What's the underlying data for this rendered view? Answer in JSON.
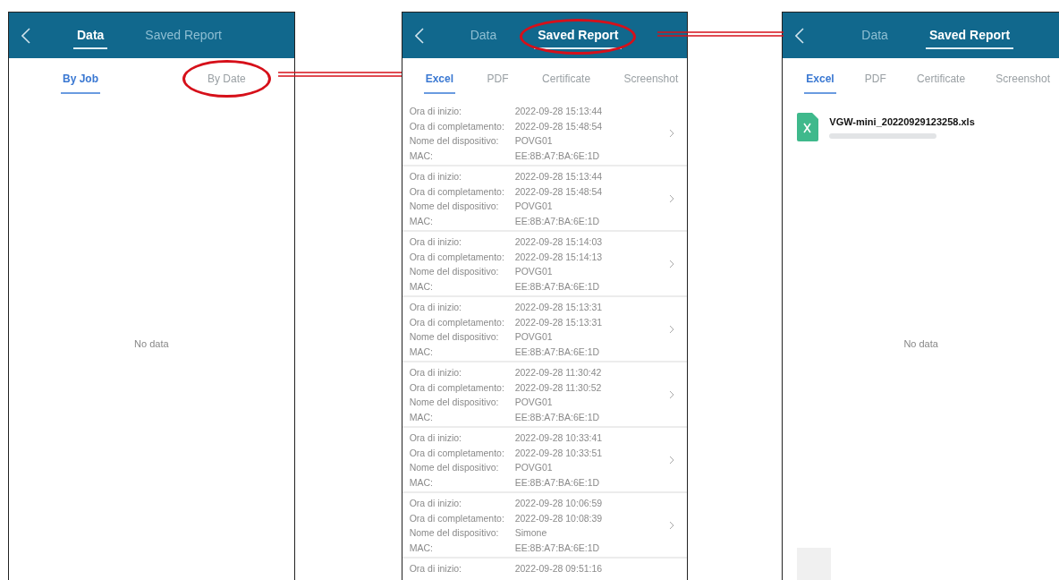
{
  "screens": [
    {
      "header": {
        "tabs": [
          {
            "label": "Data",
            "selected": true,
            "circled": false
          },
          {
            "label": "Saved Report",
            "selected": false,
            "circled": false
          }
        ]
      },
      "subtabs": [
        {
          "label": "By Job",
          "selected": true,
          "circled": false
        },
        {
          "label": "By Date",
          "selected": false,
          "circled": true
        }
      ],
      "content": {
        "kind": "empty",
        "message": "No data"
      }
    },
    {
      "header": {
        "tabs": [
          {
            "label": "Data",
            "selected": false,
            "circled": false
          },
          {
            "label": "Saved Report",
            "selected": true,
            "circled": true
          }
        ]
      },
      "subtabs": [
        {
          "label": "Excel",
          "selected": true,
          "circled": false
        },
        {
          "label": "PDF",
          "selected": false,
          "circled": false
        },
        {
          "label": "Certificate",
          "selected": false,
          "circled": false
        },
        {
          "label": "Screenshot",
          "selected": false,
          "circled": false
        }
      ],
      "content": {
        "kind": "list",
        "rows": [
          {
            "fields": [
              {
                "label": "Ora di inizio:",
                "value": "2022-09-28 15:13:44"
              },
              {
                "label": "Ora di completamento:",
                "value": "2022-09-28 15:48:54"
              },
              {
                "label": "Nome del dispositivo:",
                "value": "POVG01"
              },
              {
                "label": "MAC:",
                "value": "EE:8B:A7:BA:6E:1D"
              }
            ]
          },
          {
            "fields": [
              {
                "label": "Ora di inizio:",
                "value": "2022-09-28 15:13:44"
              },
              {
                "label": "Ora di completamento:",
                "value": "2022-09-28 15:48:54"
              },
              {
                "label": "Nome del dispositivo:",
                "value": "POVG01"
              },
              {
                "label": "MAC:",
                "value": "EE:8B:A7:BA:6E:1D"
              }
            ]
          },
          {
            "fields": [
              {
                "label": "Ora di inizio:",
                "value": "2022-09-28 15:14:03"
              },
              {
                "label": "Ora di completamento:",
                "value": "2022-09-28 15:14:13"
              },
              {
                "label": "Nome del dispositivo:",
                "value": "POVG01"
              },
              {
                "label": "MAC:",
                "value": "EE:8B:A7:BA:6E:1D"
              }
            ]
          },
          {
            "fields": [
              {
                "label": "Ora di inizio:",
                "value": "2022-09-28 15:13:31"
              },
              {
                "label": "Ora di completamento:",
                "value": "2022-09-28 15:13:31"
              },
              {
                "label": "Nome del dispositivo:",
                "value": "POVG01"
              },
              {
                "label": "MAC:",
                "value": "EE:8B:A7:BA:6E:1D"
              }
            ]
          },
          {
            "fields": [
              {
                "label": "Ora di inizio:",
                "value": "2022-09-28 11:30:42"
              },
              {
                "label": "Ora di completamento:",
                "value": "2022-09-28 11:30:52"
              },
              {
                "label": "Nome del dispositivo:",
                "value": "POVG01"
              },
              {
                "label": "MAC:",
                "value": "EE:8B:A7:BA:6E:1D"
              }
            ]
          },
          {
            "fields": [
              {
                "label": "Ora di inizio:",
                "value": "2022-09-28 10:33:41"
              },
              {
                "label": "Ora di completamento:",
                "value": "2022-09-28 10:33:51"
              },
              {
                "label": "Nome del dispositivo:",
                "value": "POVG01"
              },
              {
                "label": "MAC:",
                "value": "EE:8B:A7:BA:6E:1D"
              }
            ]
          },
          {
            "fields": [
              {
                "label": "Ora di inizio:",
                "value": "2022-09-28 10:06:59"
              },
              {
                "label": "Ora di completamento:",
                "value": "2022-09-28 10:08:39"
              },
              {
                "label": "Nome del dispositivo:",
                "value": "Simone"
              },
              {
                "label": "MAC:",
                "value": "EE:8B:A7:BA:6E:1D"
              }
            ]
          },
          {
            "fields": [
              {
                "label": "Ora di inizio:",
                "value": "2022-09-28 09:51:16"
              }
            ]
          }
        ]
      }
    },
    {
      "header": {
        "tabs": [
          {
            "label": "Data",
            "selected": false,
            "circled": false
          },
          {
            "label": "Saved Report",
            "selected": true,
            "circled": false
          }
        ]
      },
      "subtabs": [
        {
          "label": "Excel",
          "selected": true,
          "circled": false
        },
        {
          "label": "PDF",
          "selected": false,
          "circled": false
        },
        {
          "label": "Certificate",
          "selected": false,
          "circled": false
        },
        {
          "label": "Screenshot",
          "selected": false,
          "circled": false
        }
      ],
      "content": {
        "kind": "files",
        "files": [
          {
            "name": "VGW-mini_20220929123258.xls"
          }
        ],
        "message": "No data"
      }
    }
  ]
}
